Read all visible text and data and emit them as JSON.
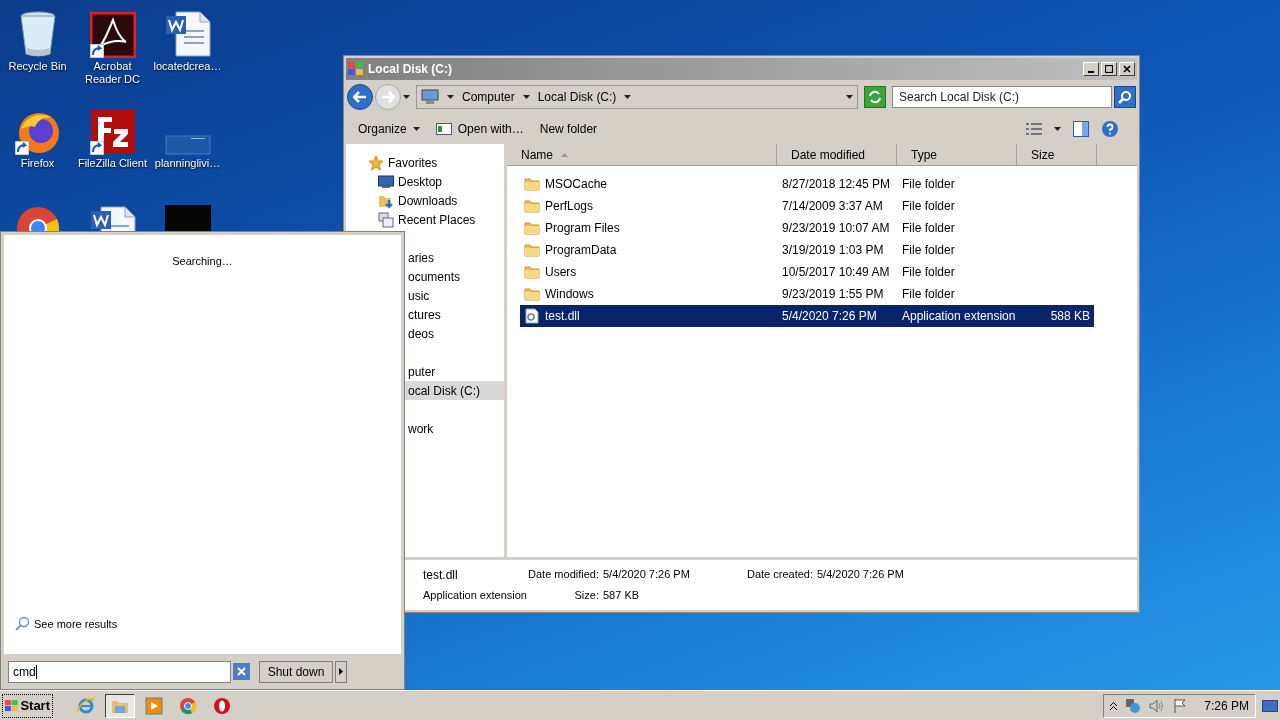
{
  "desktop_icons": [
    {
      "label": "Recycle Bin",
      "kind": "recycle",
      "shortcut": false
    },
    {
      "label": "Acrobat Reader DC",
      "kind": "acrobat",
      "shortcut": true
    },
    {
      "label": "locatedcrea…",
      "kind": "word",
      "shortcut": false
    },
    {
      "label": "Firefox",
      "kind": "firefox",
      "shortcut": true
    },
    {
      "label": "FileZilla Client",
      "kind": "filezilla",
      "shortcut": true
    },
    {
      "label": "planninglivi…",
      "kind": "blank",
      "shortcut": false
    },
    {
      "kind": "chrome",
      "shortcut": false
    },
    {
      "kind": "word",
      "shortcut": false
    },
    {
      "kind": "dark",
      "shortcut": false
    }
  ],
  "explorer": {
    "title": "Local Disk (C:)",
    "breadcrumb": [
      "Computer",
      "Local Disk (C:)"
    ],
    "search": {
      "placeholder": "Search Local Disk (C:)"
    },
    "toolbar": [
      {
        "label": "Organize",
        "kind": "menu"
      },
      {
        "label": "Open with…",
        "kind": "open"
      },
      {
        "label": "New folder",
        "kind": "plain"
      }
    ],
    "navigation": [
      {
        "label": "Favorites",
        "kind": "favorites",
        "selected": false,
        "children": [
          {
            "label": "Desktop",
            "kind": "desktop",
            "selected": false
          },
          {
            "label": "Downloads",
            "kind": "downloads",
            "selected": false
          },
          {
            "label": "Recent Places",
            "kind": "recent",
            "selected": false
          }
        ]
      },
      {
        "label": "aries",
        "kind": "covered",
        "selected": false,
        "children": [
          {
            "label": "ocuments",
            "kind": "covered",
            "selected": false
          },
          {
            "label": "usic",
            "kind": "covered",
            "selected": false
          },
          {
            "label": "ctures",
            "kind": "covered",
            "selected": false
          },
          {
            "label": "deos",
            "kind": "covered",
            "selected": false
          }
        ]
      },
      {
        "label": "puter",
        "kind": "covered",
        "selected": false,
        "children": [
          {
            "label": "ocal Disk (C:)",
            "kind": "covered",
            "selected": true
          }
        ]
      },
      {
        "label": "work",
        "kind": "covered",
        "selected": false
      }
    ],
    "columns": [
      {
        "label": "Name",
        "sorted": true
      },
      {
        "label": "Date modified",
        "sorted": false
      },
      {
        "label": "Type",
        "sorted": false
      },
      {
        "label": "Size",
        "sorted": false
      }
    ],
    "files": [
      {
        "name": "MSOCache",
        "date": "8/27/2018 12:45 PM",
        "type": "File folder",
        "kind": "folder",
        "selected": false
      },
      {
        "name": "PerfLogs",
        "date": "7/14/2009 3:37 AM",
        "type": "File folder",
        "kind": "folder",
        "selected": false
      },
      {
        "name": "Program Files",
        "date": "9/23/2019 10:07 AM",
        "type": "File folder",
        "kind": "folder",
        "selected": false
      },
      {
        "name": "ProgramData",
        "date": "3/19/2019 1:03 PM",
        "type": "File folder",
        "kind": "folder",
        "selected": false
      },
      {
        "name": "Users",
        "date": "10/5/2017 10:49 AM",
        "type": "File folder",
        "kind": "folder",
        "selected": false
      },
      {
        "name": "Windows",
        "date": "9/23/2019 1:55 PM",
        "type": "File folder",
        "kind": "folder",
        "selected": false
      },
      {
        "name": "test.dll",
        "date": "5/4/2020 7:26 PM",
        "type": "Application extension",
        "size": "588 KB",
        "kind": "dll",
        "selected": true
      }
    ],
    "details": {
      "name": "test.dll",
      "type": "Application extension",
      "fields": [
        {
          "label": "Date modified:",
          "value": "5/4/2020 7:26 PM"
        },
        {
          "label": "Date created:",
          "value": "5/4/2020 7:26 PM"
        },
        {
          "label": "Size:",
          "value": "587 KB"
        }
      ]
    }
  },
  "start_menu": {
    "status": "Searching…",
    "more_results": "See more results",
    "search_value": "cmd",
    "shutdown": "Shut down"
  },
  "taskbar": {
    "start": "Start",
    "apps": [
      {
        "kind": "ie",
        "selected": false
      },
      {
        "kind": "explorer",
        "selected": true
      },
      {
        "kind": "media",
        "selected": false
      },
      {
        "kind": "chrome",
        "selected": false
      },
      {
        "kind": "opera",
        "selected": false
      }
    ],
    "clock": "7:26 PM"
  }
}
